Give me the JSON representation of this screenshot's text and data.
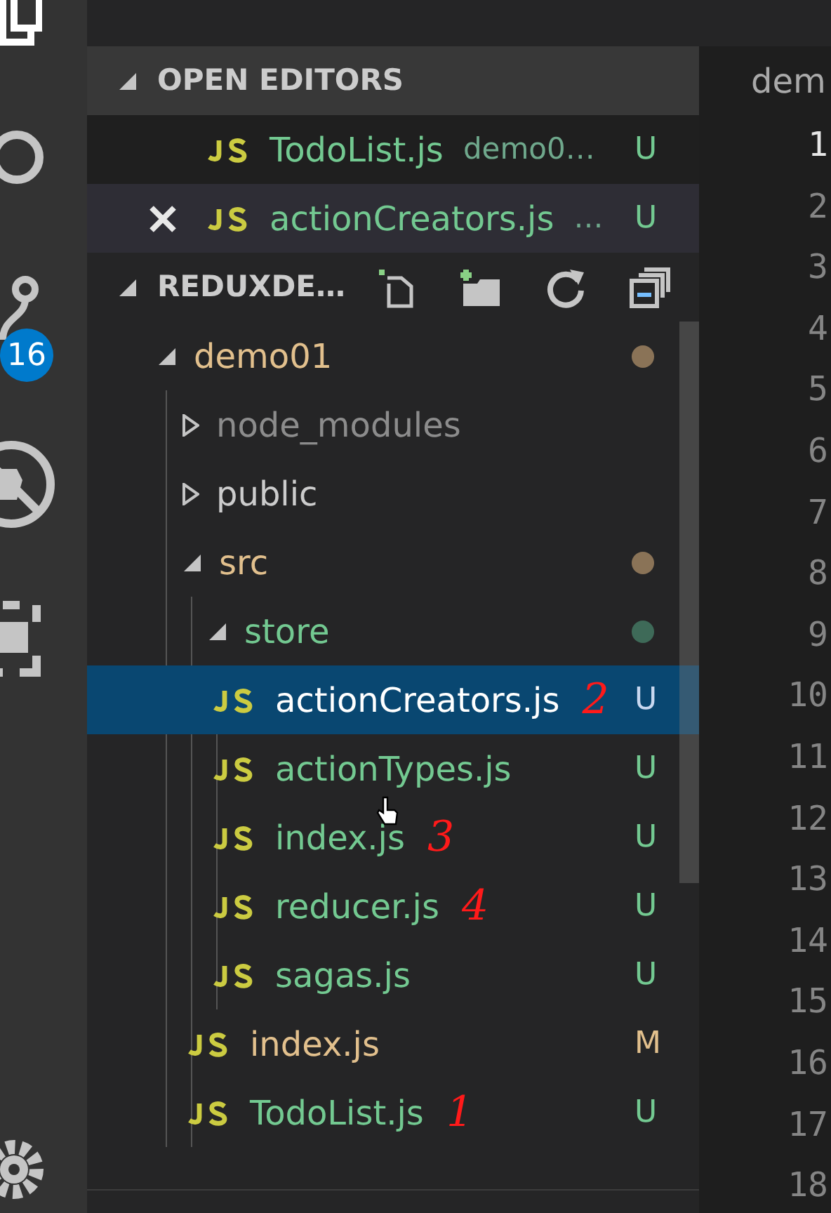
{
  "activity_bar": {
    "source_control_badge": "16"
  },
  "open_editors": {
    "title": "OPEN EDITORS",
    "expanded": true,
    "items": [
      {
        "name": "TodoList.js",
        "description": "demo0…",
        "status": "U",
        "color": "#73c991",
        "selected": true
      },
      {
        "name": "actionCreators.js",
        "description": "…",
        "status": "U",
        "color": "#73c991",
        "selected": false
      }
    ]
  },
  "folder_section": {
    "title": "REDUXDE…",
    "expanded": true
  },
  "tree": [
    {
      "kind": "folder",
      "name": "demo01",
      "color": "#e2c08d",
      "expanded": true,
      "dot": {
        "color": "#8a7357"
      },
      "children": [
        {
          "kind": "folder",
          "name": "node_modules",
          "color": "#8c8c8c",
          "expanded": false
        },
        {
          "kind": "folder",
          "name": "public",
          "color": "#cccccc",
          "expanded": false
        },
        {
          "kind": "folder",
          "name": "src",
          "color": "#e2c08d",
          "expanded": true,
          "dot": {
            "color": "#8a7357"
          },
          "children": [
            {
              "kind": "folder",
              "name": "store",
              "color": "#73c991",
              "expanded": true,
              "dot": {
                "color": "#3e6a58"
              },
              "children": [
                {
                  "kind": "file",
                  "name": "actionCreators.js",
                  "color": "#ffffff",
                  "status": "U",
                  "selected": true,
                  "annotation": "2"
                },
                {
                  "kind": "file",
                  "name": "actionTypes.js",
                  "color": "#73c991",
                  "status": "U",
                  "selected": false
                },
                {
                  "kind": "file",
                  "name": "index.js",
                  "color": "#73c991",
                  "status": "U",
                  "selected": false,
                  "annotation": "3"
                },
                {
                  "kind": "file",
                  "name": "reducer.js",
                  "color": "#73c991",
                  "status": "U",
                  "selected": false,
                  "annotation": "4"
                },
                {
                  "kind": "file",
                  "name": "sagas.js",
                  "color": "#73c991",
                  "status": "U",
                  "selected": false
                }
              ]
            },
            {
              "kind": "file",
              "name": "index.js",
              "color": "#e2c08d",
              "status": "M",
              "selected": false
            },
            {
              "kind": "file",
              "name": "TodoList.js",
              "color": "#73c991",
              "status": "U",
              "selected": false,
              "annotation": "1"
            }
          ]
        }
      ]
    }
  ],
  "editor": {
    "breadcrumb": "dem",
    "lines": [
      {
        "number": "1",
        "current": true
      },
      {
        "number": "2",
        "current": false
      },
      {
        "number": "3",
        "current": false
      },
      {
        "number": "4",
        "current": false
      },
      {
        "number": "5",
        "current": false
      },
      {
        "number": "6",
        "current": false
      },
      {
        "number": "7",
        "current": false
      },
      {
        "number": "8",
        "current": false
      },
      {
        "number": "9",
        "current": false
      },
      {
        "number": "10",
        "current": false
      },
      {
        "number": "11",
        "current": false
      },
      {
        "number": "12",
        "current": false
      },
      {
        "number": "13",
        "current": false
      },
      {
        "number": "14",
        "current": false
      },
      {
        "number": "15",
        "current": false
      },
      {
        "number": "16",
        "current": false
      },
      {
        "number": "17",
        "current": false
      },
      {
        "number": "18",
        "current": false
      }
    ]
  }
}
